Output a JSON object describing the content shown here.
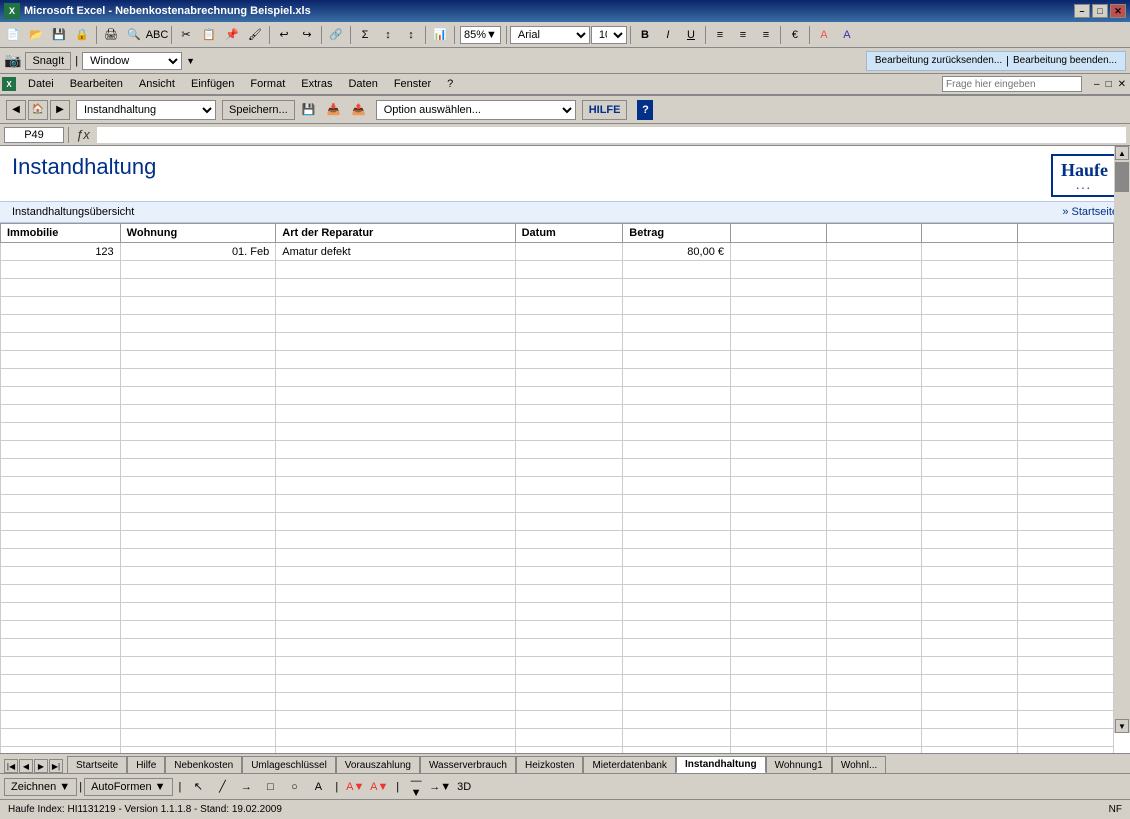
{
  "titlebar": {
    "title": "Microsoft Excel - Nebenkostenabrechnung Beispiel.xls",
    "min_btn": "–",
    "max_btn": "□",
    "close_btn": "✕"
  },
  "toolbar": {
    "zoom": "85%",
    "font": "Arial",
    "font_size": "10"
  },
  "toolbar2": {
    "snagit_label": "SnagIt",
    "icon_label": "📷",
    "window_option": "Window"
  },
  "menubar": {
    "items": [
      {
        "label": "Datei"
      },
      {
        "label": "Bearbeiten"
      },
      {
        "label": "Ansicht"
      },
      {
        "label": "Einfügen"
      },
      {
        "label": "Format"
      },
      {
        "label": "Extras"
      },
      {
        "label": "Daten"
      },
      {
        "label": "Fenster"
      },
      {
        "label": "?"
      }
    ],
    "frage_placeholder": "Frage hier eingeben",
    "win_controls": [
      "–",
      "□",
      "✕"
    ]
  },
  "formula_bar": {
    "cell_ref": "P49",
    "formula_content": ""
  },
  "haufe_toolbar": {
    "sheet_name": "Instandhaltung",
    "save_btn": "Speichern...",
    "option_placeholder": "Option auswählen...",
    "hilfe_btn": "HILFE"
  },
  "sheet": {
    "title": "Instandhaltung",
    "subtitle": "Instandhaltungsübersicht",
    "startseite_link": "» Startseite",
    "logo_text": "Haufe",
    "logo_dots": "...",
    "table": {
      "headers": [
        "Immobilie",
        "Wohnung",
        "Art der Reparatur",
        "Datum",
        "Betrag",
        "",
        "",
        "",
        ""
      ],
      "rows": [
        {
          "immobilie": "123",
          "wohnung": "01. Feb",
          "art": "Amatur defekt",
          "datum": "",
          "betrag": "80,00 €",
          "e1": "",
          "e2": "",
          "e3": "",
          "e4": ""
        },
        {
          "immobilie": "",
          "wohnung": "",
          "art": "",
          "datum": "",
          "betrag": "",
          "e1": "",
          "e2": "",
          "e3": "",
          "e4": ""
        },
        {
          "immobilie": "",
          "wohnung": "",
          "art": "",
          "datum": "",
          "betrag": "",
          "e1": "",
          "e2": "",
          "e3": "",
          "e4": ""
        },
        {
          "immobilie": "",
          "wohnung": "",
          "art": "",
          "datum": "",
          "betrag": "",
          "e1": "",
          "e2": "",
          "e3": "",
          "e4": ""
        },
        {
          "immobilie": "",
          "wohnung": "",
          "art": "",
          "datum": "",
          "betrag": "",
          "e1": "",
          "e2": "",
          "e3": "",
          "e4": ""
        },
        {
          "immobilie": "",
          "wohnung": "",
          "art": "",
          "datum": "",
          "betrag": "",
          "e1": "",
          "e2": "",
          "e3": "",
          "e4": ""
        },
        {
          "immobilie": "",
          "wohnung": "",
          "art": "",
          "datum": "",
          "betrag": "",
          "e1": "",
          "e2": "",
          "e3": "",
          "e4": ""
        },
        {
          "immobilie": "",
          "wohnung": "",
          "art": "",
          "datum": "",
          "betrag": "",
          "e1": "",
          "e2": "",
          "e3": "",
          "e4": ""
        },
        {
          "immobilie": "",
          "wohnung": "",
          "art": "",
          "datum": "",
          "betrag": "",
          "e1": "",
          "e2": "",
          "e3": "",
          "e4": ""
        },
        {
          "immobilie": "",
          "wohnung": "",
          "art": "",
          "datum": "",
          "betrag": "",
          "e1": "",
          "e2": "",
          "e3": "",
          "e4": ""
        },
        {
          "immobilie": "",
          "wohnung": "",
          "art": "",
          "datum": "",
          "betrag": "",
          "e1": "",
          "e2": "",
          "e3": "",
          "e4": ""
        },
        {
          "immobilie": "",
          "wohnung": "",
          "art": "",
          "datum": "",
          "betrag": "",
          "e1": "",
          "e2": "",
          "e3": "",
          "e4": ""
        },
        {
          "immobilie": "",
          "wohnung": "",
          "art": "",
          "datum": "",
          "betrag": "",
          "e1": "",
          "e2": "",
          "e3": "",
          "e4": ""
        },
        {
          "immobilie": "",
          "wohnung": "",
          "art": "",
          "datum": "",
          "betrag": "",
          "e1": "",
          "e2": "",
          "e3": "",
          "e4": ""
        },
        {
          "immobilie": "",
          "wohnung": "",
          "art": "",
          "datum": "",
          "betrag": "",
          "e1": "",
          "e2": "",
          "e3": "",
          "e4": ""
        },
        {
          "immobilie": "",
          "wohnung": "",
          "art": "",
          "datum": "",
          "betrag": "",
          "e1": "",
          "e2": "",
          "e3": "",
          "e4": ""
        },
        {
          "immobilie": "",
          "wohnung": "",
          "art": "",
          "datum": "",
          "betrag": "",
          "e1": "",
          "e2": "",
          "e3": "",
          "e4": ""
        },
        {
          "immobilie": "",
          "wohnung": "",
          "art": "",
          "datum": "",
          "betrag": "",
          "e1": "",
          "e2": "",
          "e3": "",
          "e4": ""
        },
        {
          "immobilie": "",
          "wohnung": "",
          "art": "",
          "datum": "",
          "betrag": "",
          "e1": "",
          "e2": "",
          "e3": "",
          "e4": ""
        },
        {
          "immobilie": "",
          "wohnung": "",
          "art": "",
          "datum": "",
          "betrag": "",
          "e1": "",
          "e2": "",
          "e3": "",
          "e4": ""
        },
        {
          "immobilie": "",
          "wohnung": "",
          "art": "",
          "datum": "",
          "betrag": "",
          "e1": "",
          "e2": "",
          "e3": "",
          "e4": ""
        },
        {
          "immobilie": "",
          "wohnung": "",
          "art": "",
          "datum": "",
          "betrag": "",
          "e1": "",
          "e2": "",
          "e3": "",
          "e4": ""
        },
        {
          "immobilie": "",
          "wohnung": "",
          "art": "",
          "datum": "",
          "betrag": "",
          "e1": "",
          "e2": "",
          "e3": "",
          "e4": ""
        },
        {
          "immobilie": "",
          "wohnung": "",
          "art": "",
          "datum": "",
          "betrag": "",
          "e1": "",
          "e2": "",
          "e3": "",
          "e4": ""
        },
        {
          "immobilie": "",
          "wohnung": "",
          "art": "",
          "datum": "",
          "betrag": "",
          "e1": "",
          "e2": "",
          "e3": "",
          "e4": ""
        },
        {
          "immobilie": "",
          "wohnung": "",
          "art": "",
          "datum": "",
          "betrag": "",
          "e1": "",
          "e2": "",
          "e3": "",
          "e4": ""
        },
        {
          "immobilie": "",
          "wohnung": "",
          "art": "",
          "datum": "",
          "betrag": "",
          "e1": "",
          "e2": "",
          "e3": "",
          "e4": ""
        },
        {
          "immobilie": "",
          "wohnung": "",
          "art": "",
          "datum": "",
          "betrag": "",
          "e1": "",
          "e2": "",
          "e3": "",
          "e4": ""
        },
        {
          "immobilie": "",
          "wohnung": "",
          "art": "",
          "datum": "",
          "betrag": "",
          "e1": "",
          "e2": "",
          "e3": "",
          "e4": ""
        },
        {
          "immobilie": "",
          "wohnung": "",
          "art": "",
          "datum": "",
          "betrag": "",
          "e1": "",
          "e2": "",
          "e3": "",
          "e4": ""
        }
      ]
    }
  },
  "sheet_tabs": [
    {
      "label": "Startseite",
      "active": false
    },
    {
      "label": "Hilfe",
      "active": false
    },
    {
      "label": "Nebenkosten",
      "active": false
    },
    {
      "label": "Umlageschlüssel",
      "active": false
    },
    {
      "label": "Vorauszahlung",
      "active": false
    },
    {
      "label": "Wasserverbrauch",
      "active": false
    },
    {
      "label": "Heizkosten",
      "active": false
    },
    {
      "label": "Mieterdatenbank",
      "active": false
    },
    {
      "label": "Instandhaltung",
      "active": true
    },
    {
      "label": "Wohnung1",
      "active": false
    },
    {
      "label": "Wohnl...",
      "active": false
    }
  ],
  "draw_toolbar": {
    "zeichnen_label": "Zeichnen ▼",
    "autoformen_label": "AutoFormen ▼"
  },
  "status_bar": {
    "left": "Haufe Index: HI1131219 - Version 1.1.1.8 - Stand: 19.02.2009",
    "right": "NF"
  },
  "bearbeitung_bar": {
    "left": "Bearbeitung zurücksenden...",
    "right": "Bearbeitung beenden..."
  }
}
